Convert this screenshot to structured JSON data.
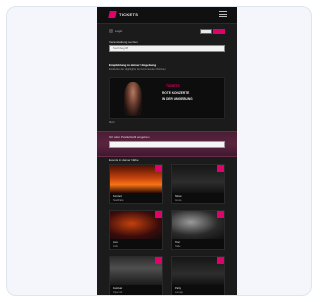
{
  "app": {
    "brand": "TICKETS"
  },
  "header": {
    "account_text": "Login",
    "toggles": [
      "",
      "",
      ""
    ]
  },
  "search": {
    "label": "Veranstaltung suchen",
    "placeholder": "Suchbegriff"
  },
  "promo": {
    "title": "Empfehlung in deiner Umgebung",
    "subtitle": "Entdecke die Highlights der kommenden Wochen",
    "brand_text": "TICKETS",
    "lines": [
      "ROTE KONZERTE",
      "IN DER UMGEBUNG"
    ],
    "caption": "Mehr"
  },
  "stripe": {
    "label": "Ort oder Postleitzahl eingeben"
  },
  "events": {
    "title": "Events in deiner Nähe",
    "tiles": [
      {
        "name": "Konzert",
        "meta": "Stadthalle"
      },
      {
        "name": "Show",
        "meta": "Arena"
      },
      {
        "name": "Live",
        "meta": "Club"
      },
      {
        "name": "Tour",
        "meta": "Halle"
      },
      {
        "name": "Festival",
        "meta": "Open Air"
      },
      {
        "name": "Party",
        "meta": "Lounge"
      }
    ]
  },
  "colors": {
    "accent": "#e2006a",
    "background": "#1b1b1b"
  },
  "icons": {
    "menu": "hamburger-icon",
    "user": "user-icon"
  }
}
